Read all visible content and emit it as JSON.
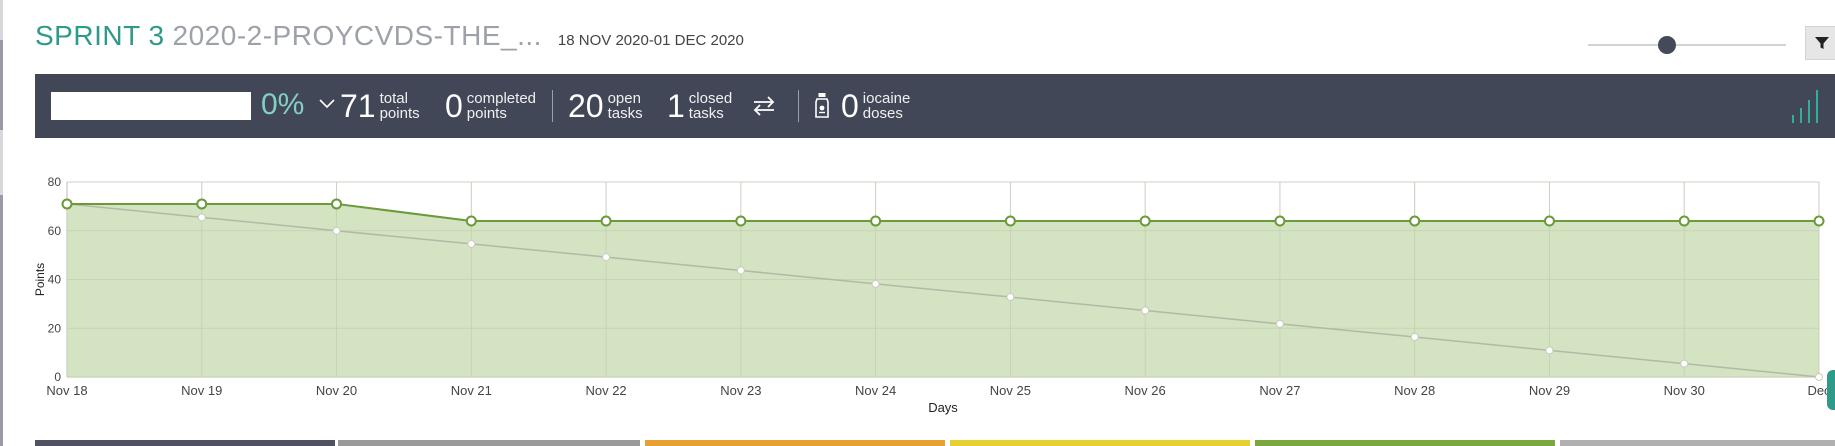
{
  "header": {
    "sprint_label": "SPRINT 3",
    "project_name": "2020-2-PROYCVDS-THE_...",
    "date_range": "18 NOV 2020-01 DEC 2020"
  },
  "zoom_slider": {
    "value": 0.4
  },
  "summary": {
    "progress_fraction": 0,
    "percent": "0%",
    "total_points": {
      "value": "71",
      "line1": "total",
      "line2": "points"
    },
    "completed_points": {
      "value": "0",
      "line1": "completed",
      "line2": "points"
    },
    "open_tasks": {
      "value": "20",
      "line1": "open",
      "line2": "tasks"
    },
    "closed_tasks": {
      "value": "1",
      "line1": "closed",
      "line2": "tasks"
    },
    "iocaine": {
      "value": "0",
      "line1": "iocaine",
      "line2": "doses"
    }
  },
  "icons": {
    "chevron": "chevron-down-icon",
    "swap": "swap-arrows-icon",
    "iocaine": "iocaine-bottle-icon",
    "graph_toggle": "bar-graph-icon",
    "filter": "filter-icon"
  },
  "colors": {
    "accent_teal": "#2e9a8a",
    "bar_dark": "#424757",
    "real_line": "#6a9a3a",
    "real_fill": "#d4e3c2",
    "optimal_fill": "#c2c9b5",
    "percent_color": "#83cfc4"
  },
  "chart_data": {
    "type": "area",
    "xlabel": "Days",
    "ylabel": "Points",
    "ylim": [
      0,
      80
    ],
    "yticks": [
      "0",
      "20",
      "40",
      "60",
      "80"
    ],
    "categories": [
      "Nov 18",
      "Nov 19",
      "Nov 20",
      "Nov 21",
      "Nov 22",
      "Nov 23",
      "Nov 24",
      "Nov 25",
      "Nov 26",
      "Nov 27",
      "Nov 28",
      "Nov 29",
      "Nov 30",
      "Dec"
    ],
    "series": [
      {
        "values": [
          71,
          71,
          71,
          64,
          64,
          64,
          64,
          64,
          64,
          64,
          64,
          64,
          64,
          64
        ]
      },
      {
        "values": [
          71,
          65.5,
          60,
          54.6,
          49.2,
          43.7,
          38.2,
          32.8,
          27.3,
          21.8,
          16.4,
          10.9,
          5.5,
          0
        ]
      }
    ]
  },
  "bottom_tabs": [
    "#4e5263",
    "#9a9a9a",
    "#e8a030",
    "#e8d030",
    "#7aa83c",
    "#b0b0b0"
  ]
}
